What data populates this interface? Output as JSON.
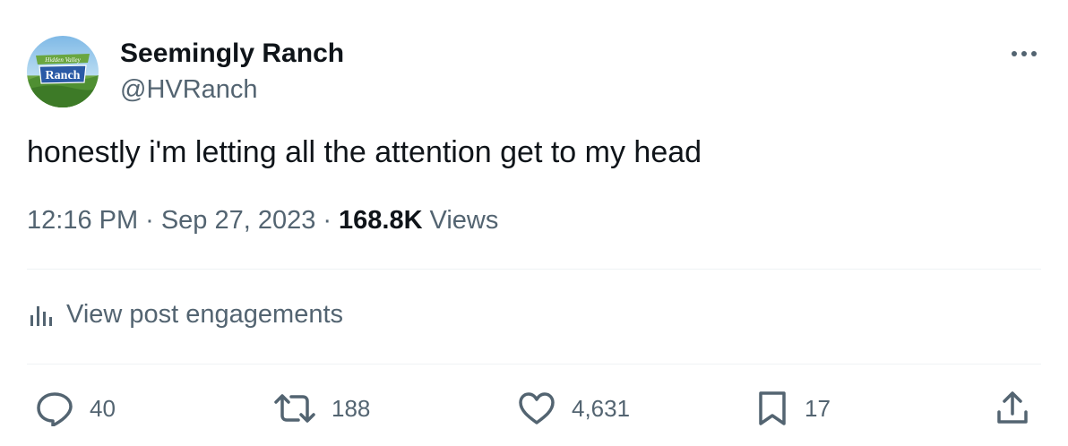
{
  "author": {
    "display_name": "Seemingly Ranch",
    "handle": "@HVRanch",
    "avatar_icon": "hidden-valley-ranch-logo",
    "avatar_logo_line1": "Hidden Valley",
    "avatar_logo_line2": "Ranch"
  },
  "tweet": {
    "text": "honestly i'm letting all the attention get to my head",
    "time": "12:16 PM",
    "separator": "·",
    "date": "Sep 27, 2023",
    "views_count": "168.8K",
    "views_label": "Views"
  },
  "engagements_link": {
    "icon": "bar-chart-icon",
    "label": "View post engagements"
  },
  "actions": {
    "reply": {
      "icon": "reply-icon",
      "count": "40"
    },
    "repost": {
      "icon": "repost-icon",
      "count": "188"
    },
    "like": {
      "icon": "heart-icon",
      "count": "4,631"
    },
    "bookmark": {
      "icon": "bookmark-icon",
      "count": "17"
    },
    "share": {
      "icon": "share-icon"
    }
  },
  "colors": {
    "primary_text": "#0f1419",
    "secondary_text": "#536471",
    "divider": "#eff3f4",
    "logo_blue": "#2a5aa6",
    "logo_green": "#5a9a3c"
  }
}
